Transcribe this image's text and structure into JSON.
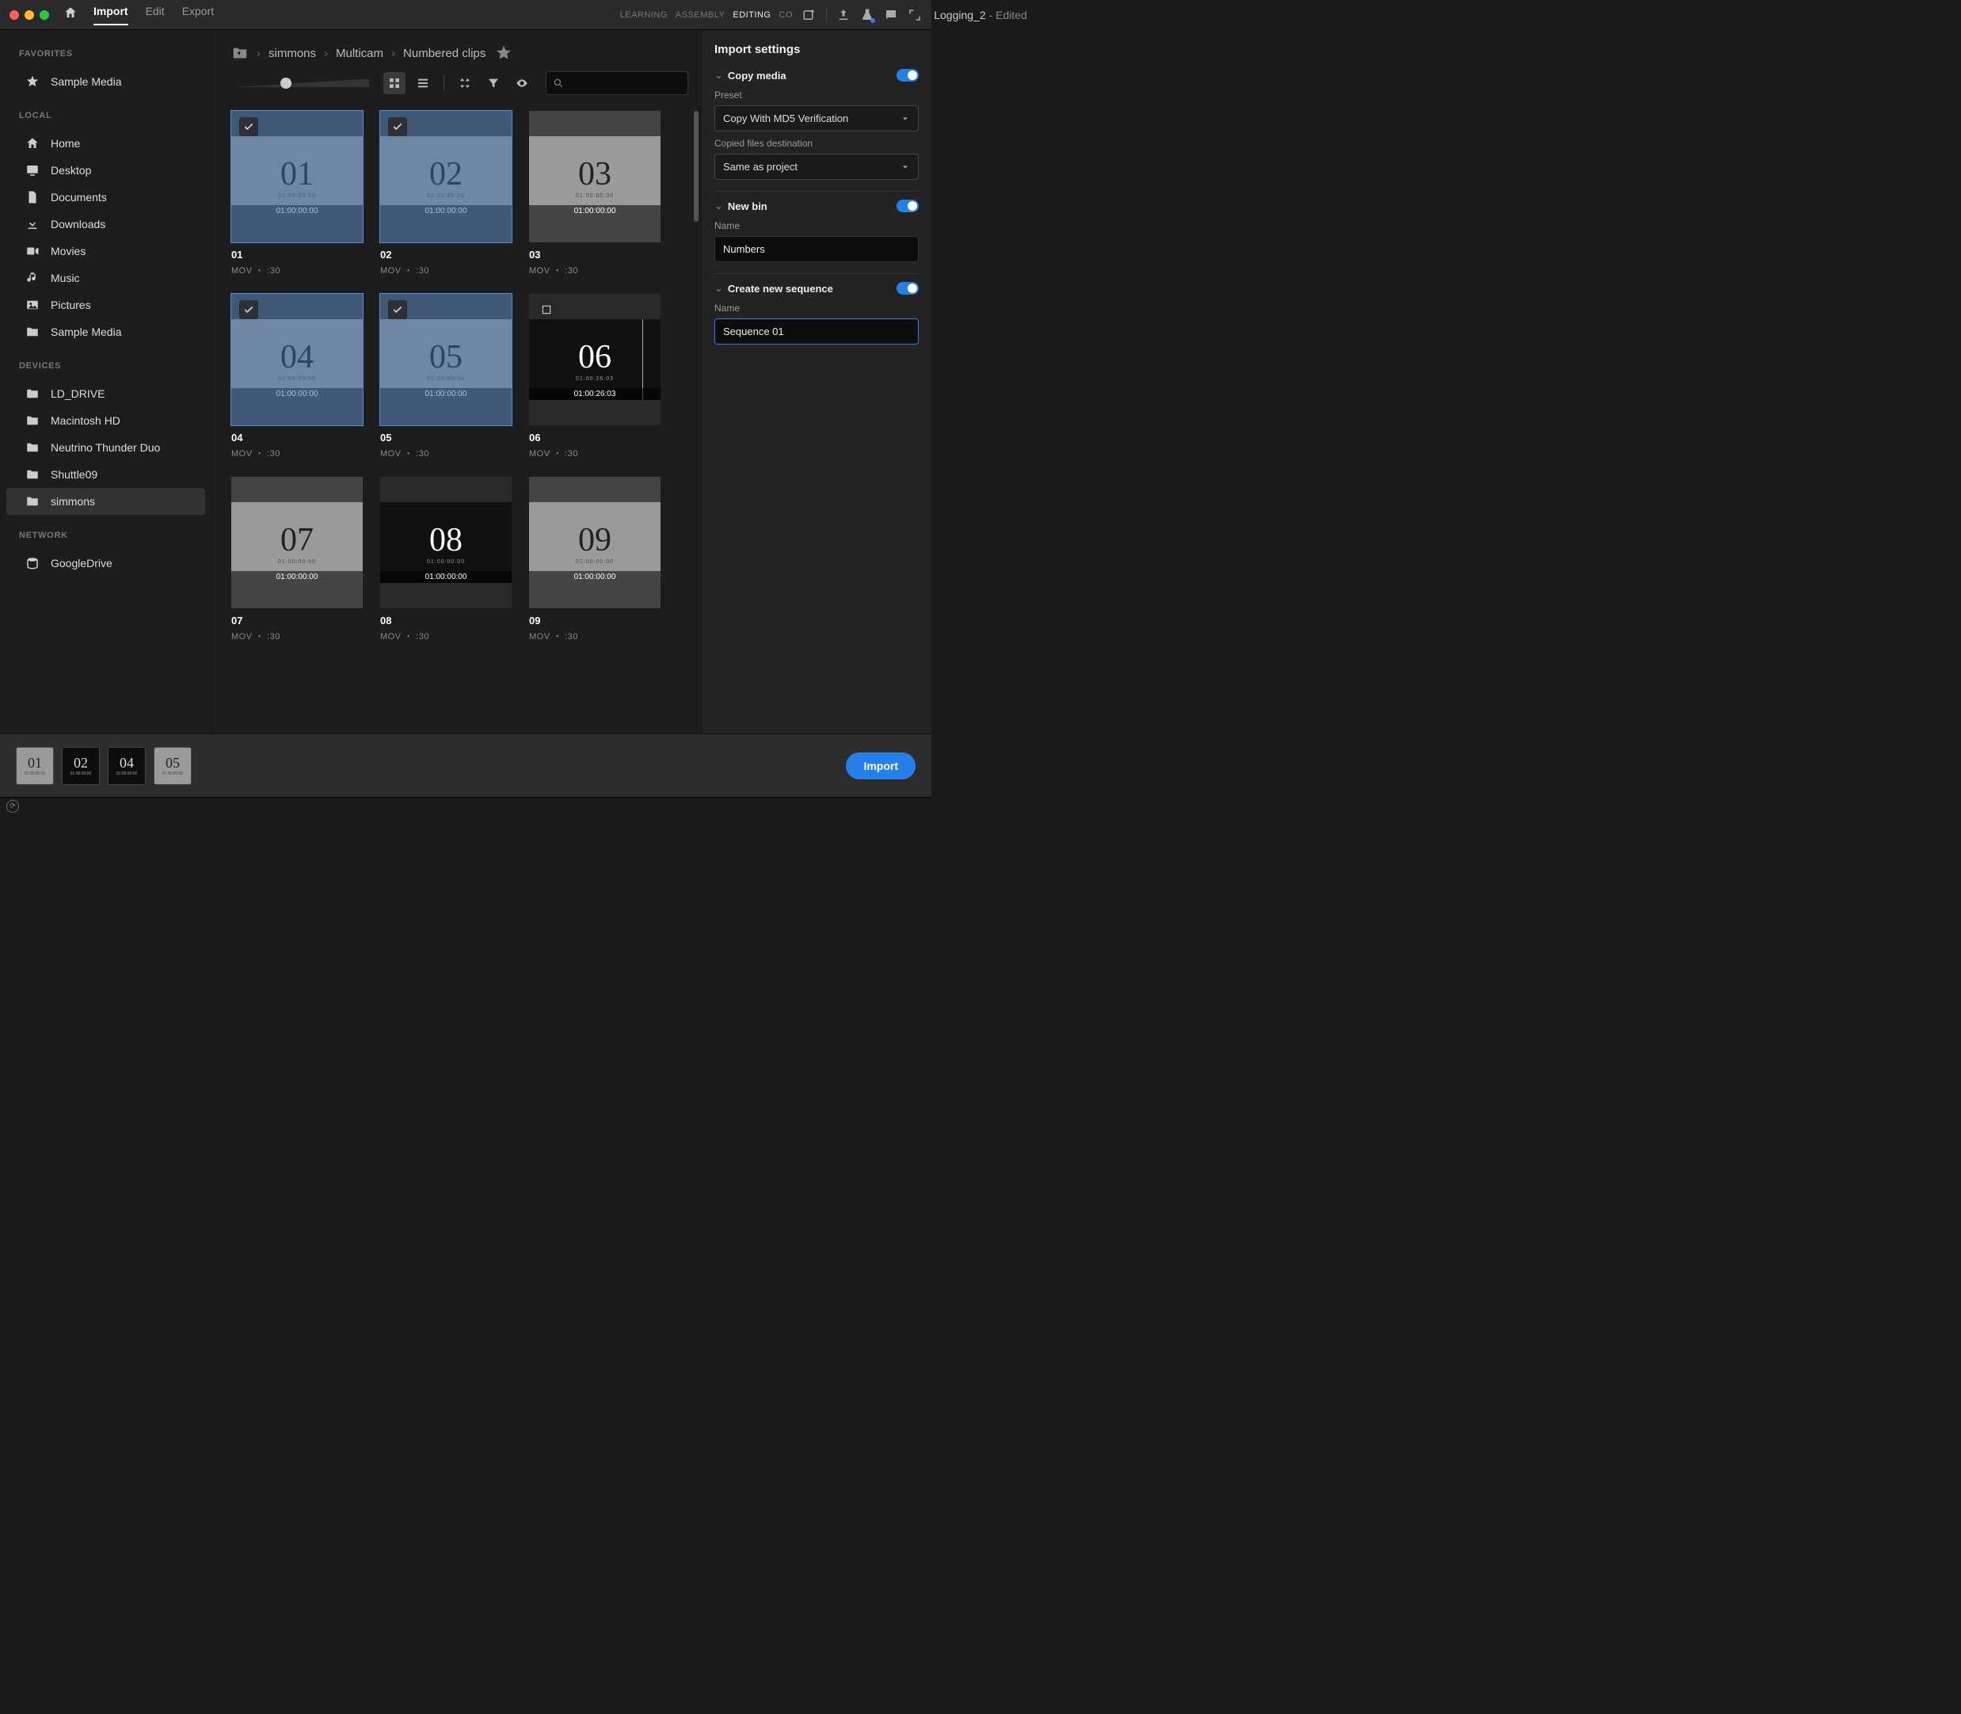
{
  "titlebar": {
    "tabs": [
      "Import",
      "Edit",
      "Export"
    ],
    "active_tab": 0,
    "document": "Logging_2",
    "document_suffix": " - Edited",
    "workspaces": [
      "LEARNING",
      "ASSEMBLY",
      "EDITING",
      "CO"
    ],
    "active_workspace": 2
  },
  "sidebar": {
    "groups": [
      {
        "header": "FAVORITES",
        "items": [
          {
            "icon": "star",
            "label": "Sample Media"
          }
        ]
      },
      {
        "header": "LOCAL",
        "items": [
          {
            "icon": "home",
            "label": "Home"
          },
          {
            "icon": "desktop",
            "label": "Desktop"
          },
          {
            "icon": "file",
            "label": "Documents"
          },
          {
            "icon": "download",
            "label": "Downloads"
          },
          {
            "icon": "video",
            "label": "Movies"
          },
          {
            "icon": "music",
            "label": "Music"
          },
          {
            "icon": "image",
            "label": "Pictures"
          },
          {
            "icon": "folder",
            "label": "Sample Media"
          }
        ]
      },
      {
        "header": "DEVICES",
        "items": [
          {
            "icon": "folder",
            "label": "LD_DRIVE"
          },
          {
            "icon": "folder",
            "label": "Macintosh HD"
          },
          {
            "icon": "folder",
            "label": "Neutrino Thunder Duo"
          },
          {
            "icon": "folder",
            "label": "Shuttle09"
          },
          {
            "icon": "folder",
            "label": "simmons",
            "active": true
          }
        ]
      },
      {
        "header": "NETWORK",
        "items": [
          {
            "icon": "drive",
            "label": "GoogleDrive"
          }
        ]
      }
    ]
  },
  "breadcrumb": [
    "simmons",
    "Multicam",
    "Numbered clips"
  ],
  "clips": [
    {
      "num": "01",
      "name": "01",
      "meta": "MOV ・ :30",
      "tc": "01:00:00:00",
      "tiny": "01:00:00:00",
      "selected": true,
      "checked": true,
      "dark": false
    },
    {
      "num": "02",
      "name": "02",
      "meta": "MOV ・ :30",
      "tc": "01:00:00:00",
      "tiny": "01:00:00:00",
      "selected": true,
      "checked": true,
      "dark": false
    },
    {
      "num": "03",
      "name": "03",
      "meta": "MOV ・ :30",
      "tc": "01:00:00:00",
      "tiny": "01:00:00:00",
      "selected": false,
      "dark": false
    },
    {
      "num": "04",
      "name": "04",
      "meta": "MOV ・ :30",
      "tc": "01:00:00:00",
      "tiny": "01:00:00:00",
      "selected": true,
      "checked": true,
      "dark": false
    },
    {
      "num": "05",
      "name": "05",
      "meta": "MOV ・ :30",
      "tc": "01:00:00:00",
      "tiny": "01:00:00:00",
      "selected": true,
      "checked": true,
      "dark": false
    },
    {
      "num": "06",
      "name": "06",
      "meta": "MOV ・ :30",
      "tc": "01:00:26:03",
      "tiny": "01:00:26:03",
      "selected": false,
      "checked": false,
      "dark": true,
      "scrub": true
    },
    {
      "num": "07",
      "name": "07",
      "meta": "MOV ・ :30",
      "tc": "01:00:00:00",
      "tiny": "01:00:00:00",
      "selected": false,
      "dark": false
    },
    {
      "num": "08",
      "name": "08",
      "meta": "MOV ・ :30",
      "tc": "01:00:00:00",
      "tiny": "01:00:00:00",
      "selected": false,
      "dark": true
    },
    {
      "num": "09",
      "name": "09",
      "meta": "MOV ・ :30",
      "tc": "01:00:00:00",
      "tiny": "01:00:00:00",
      "selected": false,
      "dark": false
    }
  ],
  "settings": {
    "title": "Import settings",
    "copy_media": {
      "label": "Copy media",
      "on": true,
      "preset_label": "Preset",
      "preset_value": "Copy With MD5 Verification",
      "dest_label": "Copied files destination",
      "dest_value": "Same as project"
    },
    "new_bin": {
      "label": "New bin",
      "on": true,
      "name_label": "Name",
      "name_value": "Numbers"
    },
    "new_seq": {
      "label": "Create new sequence",
      "on": true,
      "name_label": "Name",
      "name_value": "Sequence 01"
    }
  },
  "tray": [
    {
      "num": "01",
      "tc": "01:00:00:00",
      "light": true
    },
    {
      "num": "02",
      "tc": "01:00:00:00",
      "light": false
    },
    {
      "num": "04",
      "tc": "01:00:00:00",
      "light": false
    },
    {
      "num": "05",
      "tc": "01:00:00:00",
      "light": true
    }
  ],
  "import_button": "Import"
}
